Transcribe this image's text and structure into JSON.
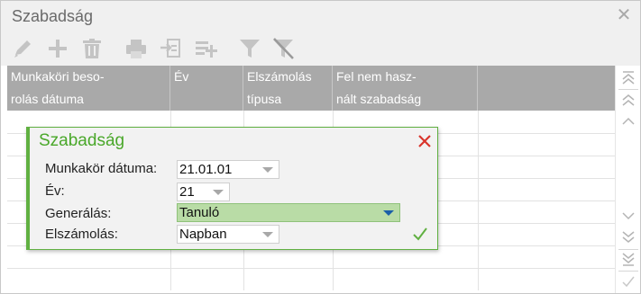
{
  "window": {
    "title": "Szabadság",
    "close_icon": "close-icon"
  },
  "toolbar": {
    "buttons": [
      {
        "name": "edit",
        "icon": "pencil-icon"
      },
      {
        "name": "add",
        "icon": "plus-icon"
      },
      {
        "name": "delete",
        "icon": "trash-icon"
      },
      {
        "name": "print",
        "icon": "printer-icon"
      },
      {
        "name": "export",
        "icon": "export-icon"
      },
      {
        "name": "add-rows",
        "icon": "add-rows-icon"
      },
      {
        "name": "filter",
        "icon": "filter-icon"
      },
      {
        "name": "clear-filter",
        "icon": "filter-clear-icon"
      }
    ]
  },
  "grid": {
    "columns": [
      {
        "line1": "Munkaköri beso-",
        "line2": "rolás dátuma"
      },
      {
        "line1": "Év",
        "line2": ""
      },
      {
        "line1": "Elszámolás",
        "line2": "típusa"
      },
      {
        "line1": "Fel nem hasz-",
        "line2": "nált szabadság"
      },
      {
        "line1": "",
        "line2": ""
      }
    ]
  },
  "dialog": {
    "title": "Szabadság",
    "fields": {
      "munkakor_datuma": {
        "label": "Munkakör dátuma:",
        "value": "21.01.01"
      },
      "ev": {
        "label": "Év:",
        "value": "21"
      },
      "generalas": {
        "label": "Generálás:",
        "value": "Tanuló"
      },
      "elszamolas": {
        "label": "Elszámolás:",
        "value": "Napban"
      }
    }
  },
  "colors": {
    "accent_green": "#60b041",
    "title_green": "#4aa82a",
    "header_gray": "#a9a9a9",
    "highlight_field": "#b9dca6",
    "dropdown_caret_blue": "#1a5fa8",
    "close_red": "#d9342b"
  }
}
